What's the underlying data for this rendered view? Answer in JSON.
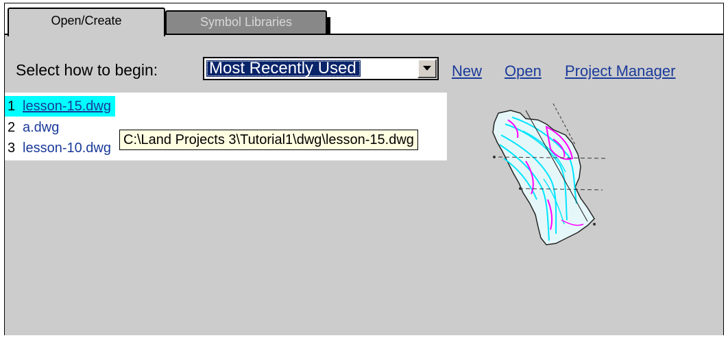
{
  "tabs": [
    {
      "label": "Open/Create",
      "active": true
    },
    {
      "label": "Symbol Libraries",
      "active": false
    }
  ],
  "begin": {
    "label": "Select how to begin:",
    "selected_option": "Most Recently Used"
  },
  "links": {
    "new": "New",
    "open": "Open",
    "project_manager": "Project Manager"
  },
  "recent_files": [
    {
      "num": "1",
      "name": "lesson-15.dwg"
    },
    {
      "num": "2",
      "name": "a.dwg"
    },
    {
      "num": "3",
      "name": "lesson-10.dwg"
    }
  ],
  "tooltip": "C:\\Land Projects 3\\Tutorial1\\dwg\\lesson-15.dwg",
  "colors": {
    "panel_bg": "#cccccc",
    "link": "#1a3a9a",
    "highlight": "#00ffff",
    "selection": "#0a246a",
    "tooltip_bg": "#ffffe1",
    "contour_cyan": "#00e5ff",
    "contour_magenta": "#ff00ff"
  },
  "preview": {
    "icon": "drawing-thumbnail"
  }
}
